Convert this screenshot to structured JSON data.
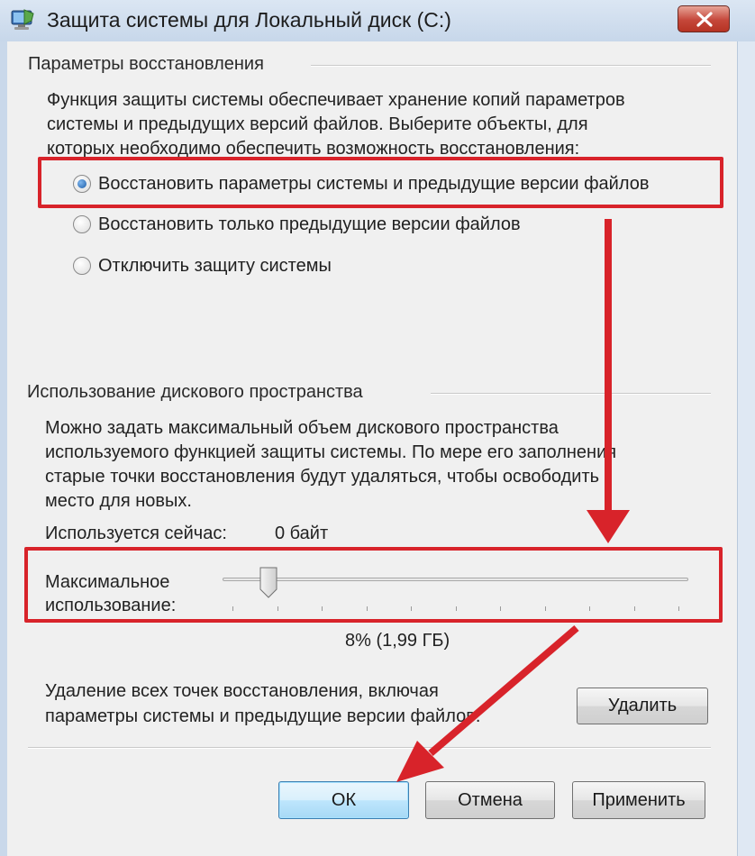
{
  "window": {
    "title": "Защита системы для Локальный диск (С:)",
    "app_icon": "system-protection-icon",
    "close_icon": "close-icon"
  },
  "restore": {
    "group_title": "Параметры восстановления",
    "description": [
      "Функция защиты системы обеспечивает хранение копий параметров",
      "системы и предыдущих версий файлов. Выберите объекты, для",
      "которых необходимо обеспечить возможность восстановления:"
    ],
    "options": [
      {
        "label": "Восстановить параметры системы и предыдущие версии файлов",
        "checked": true
      },
      {
        "label": "Восстановить только предыдущие версии файлов",
        "checked": false
      },
      {
        "label": "Отключить защиту системы",
        "checked": false
      }
    ]
  },
  "disk": {
    "group_title": "Использование дискового пространства",
    "description": [
      "Можно задать максимальный объем дискового пространства",
      "используемого функцией защиты системы. По мере его заполнения",
      "старые точки восстановления будут удаляться, чтобы освободить",
      "место для новых."
    ],
    "current_label": "Используется сейчас:",
    "current_value": "0 байт",
    "max_label_line1": "Максимальное",
    "max_label_line2": "использование:",
    "slider_percent": 8,
    "slider_value_text": "8% (1,99 ГБ)",
    "delete_text_line1": "Удаление всех точек восстановления, включая",
    "delete_text_line2": "параметры системы и предыдущие версии файлов.",
    "delete_button": "Удалить"
  },
  "buttons": {
    "ok": "ОК",
    "cancel": "Отмена",
    "apply": "Применить"
  },
  "annotation": {
    "color": "#d8232a"
  }
}
